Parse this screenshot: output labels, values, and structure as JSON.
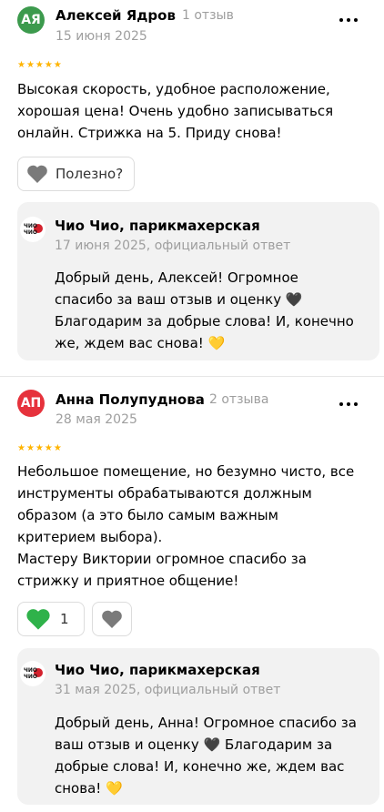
{
  "reviews": [
    {
      "initials": "АЯ",
      "avatar_color": "#3c9a4d",
      "author": "Алексей Ядров",
      "review_count": "1 отзыв",
      "date": "15 июня 2025",
      "rating": 5,
      "stars": "★★★★★",
      "text": "Высокая скорость, удобное расположение,\nхорошая цена! Очень удобно записываться\nонлайн. Стрижка на 5. Приду снова!",
      "useful_label": "Полезно?",
      "reply": {
        "business": "Чио Чио, парикмахерская",
        "date": "17 июня 2025, официальный ответ",
        "text": "Добрый день, Алексей! Огромное\nспасибо за ваш отзыв и оценку 🖤\nБлагодарим за добрые слова! И, конечно\nже, ждем вас снова! 💛"
      }
    },
    {
      "initials": "АП",
      "avatar_color": "#e6323c",
      "author": "Анна Полупуднова",
      "review_count": "2 отзыва",
      "date": "28 мая 2025",
      "rating": 5,
      "stars": "★★★★★",
      "text": "Небольшое помещение, но безумно чисто, все\nинструменты обрабатываются должным\nобразом (а это было самым важным\nкритерием выбора).\nМастеру Виктории огромное спасибо за\nстрижку и приятное общение!",
      "like_count": "1",
      "reply": {
        "business": "Чио Чио, парикмахерская",
        "date": "31 мая 2025, официальный ответ",
        "text": "Добрый день, Анна! Огромное спасибо за\nваш отзыв и оценку 🖤 Благодарим за\nдобрые слова! И, конечно же, ждем вас\nснова! 💛"
      }
    }
  ],
  "logo_text": "ЧИО ЧИО",
  "colors": {
    "heart_gray": "#7a7a7a",
    "heart_green": "#2fb24a",
    "star": "#ffb400",
    "reply_bg": "#f2f2f2"
  }
}
